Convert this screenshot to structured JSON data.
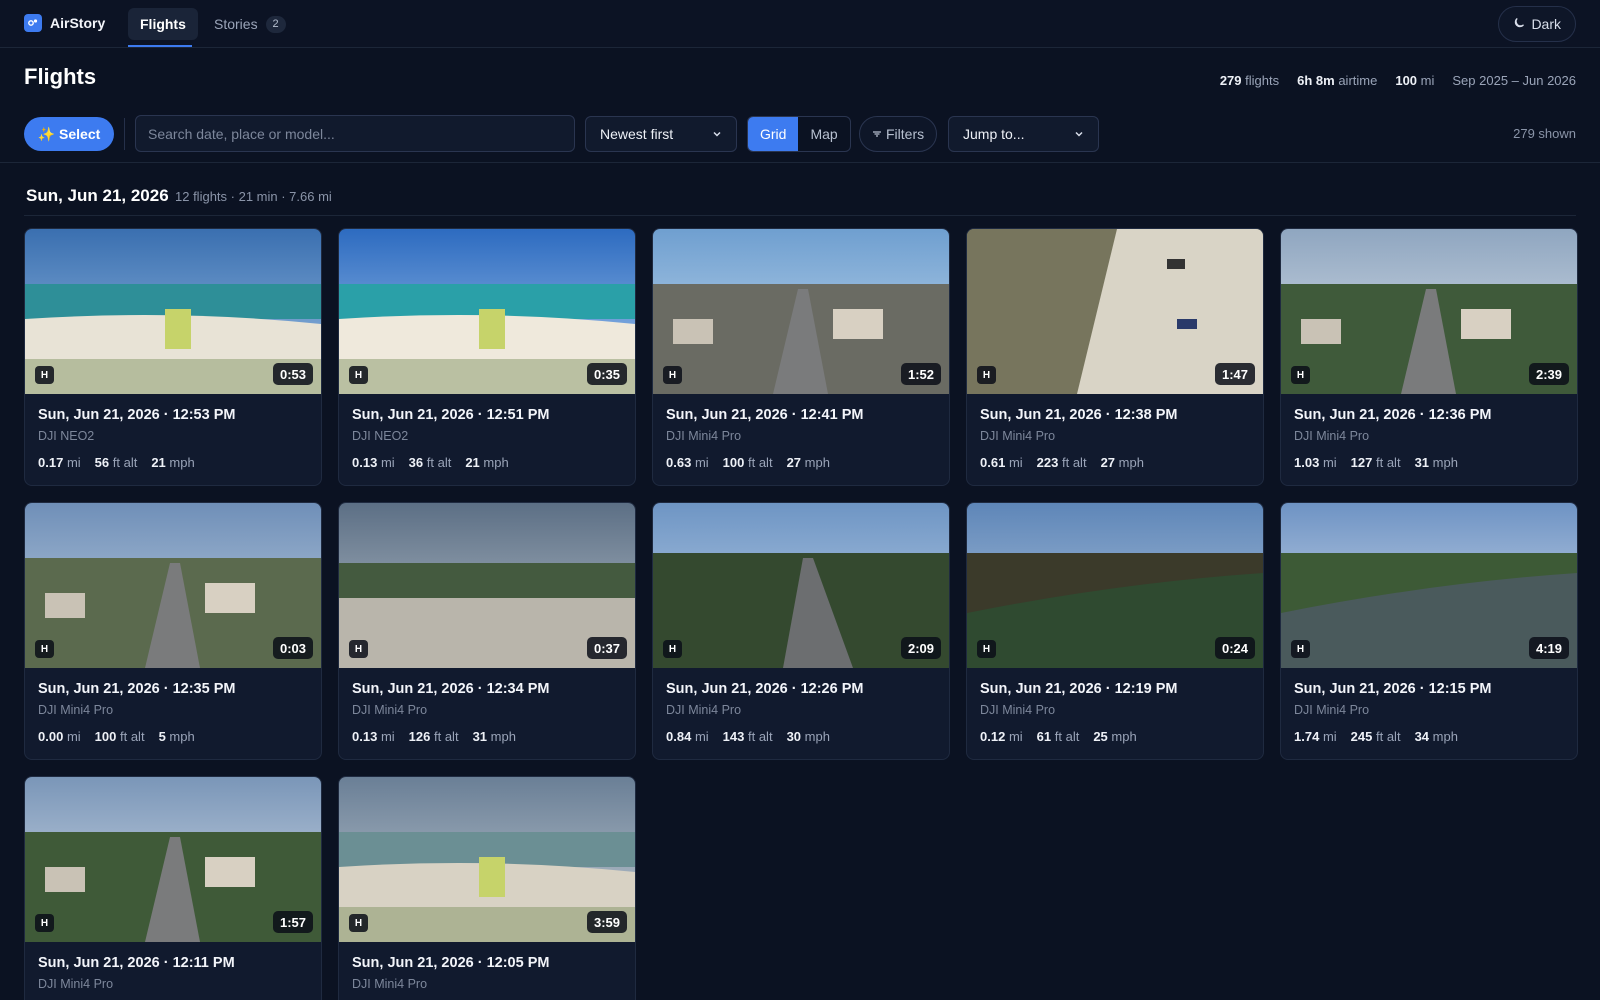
{
  "app": {
    "name": "AirStory"
  },
  "nav": {
    "tabs": [
      {
        "label": "Flights"
      },
      {
        "label": "Stories",
        "badge": "2"
      }
    ],
    "theme_label": "Dark"
  },
  "header": {
    "title": "Flights",
    "stats": {
      "flights_value": "279",
      "flights_unit": "flights",
      "airtime_value": "6h 8m",
      "airtime_unit": "airtime",
      "distance_value": "100",
      "distance_unit": "mi",
      "date_range": "Sep 2025 – Jun 2026"
    }
  },
  "toolbar": {
    "select_label": "✨ Select",
    "search_placeholder": "Search date, place or model...",
    "sort_value": "Newest first",
    "view_grid": "Grid",
    "view_map": "Map",
    "filters_label": "Filters",
    "jump_value": "Jump to...",
    "shown_text": "279 shown"
  },
  "group": {
    "title": "Sun, Jun 21, 2026",
    "meta": "12 flights · 21 min · 7.66 mi"
  },
  "flights": [
    {
      "title": "Sun, Jun 21, 2026 · 12:53 PM",
      "model": "DJI NEO2",
      "duration": "0:53",
      "badge": "H",
      "dist": "0.17",
      "alt": "56",
      "speed": "21"
    },
    {
      "title": "Sun, Jun 21, 2026 · 12:51 PM",
      "model": "DJI NEO2",
      "duration": "0:35",
      "badge": "H",
      "dist": "0.13",
      "alt": "36",
      "speed": "21"
    },
    {
      "title": "Sun, Jun 21, 2026 · 12:41 PM",
      "model": "DJI Mini4 Pro",
      "duration": "1:52",
      "badge": "H",
      "dist": "0.63",
      "alt": "100",
      "speed": "27"
    },
    {
      "title": "Sun, Jun 21, 2026 · 12:38 PM",
      "model": "DJI Mini4 Pro",
      "duration": "1:47",
      "badge": "H",
      "dist": "0.61",
      "alt": "223",
      "speed": "27"
    },
    {
      "title": "Sun, Jun 21, 2026 · 12:36 PM",
      "model": "DJI Mini4 Pro",
      "duration": "2:39",
      "badge": "H",
      "dist": "1.03",
      "alt": "127",
      "speed": "31"
    },
    {
      "title": "Sun, Jun 21, 2026 · 12:35 PM",
      "model": "DJI Mini4 Pro",
      "duration": "0:03",
      "badge": "H",
      "dist": "0.00",
      "alt": "100",
      "speed": "5"
    },
    {
      "title": "Sun, Jun 21, 2026 · 12:34 PM",
      "model": "DJI Mini4 Pro",
      "duration": "0:37",
      "badge": "H",
      "dist": "0.13",
      "alt": "126",
      "speed": "31"
    },
    {
      "title": "Sun, Jun 21, 2026 · 12:26 PM",
      "model": "DJI Mini4 Pro",
      "duration": "2:09",
      "badge": "H",
      "dist": "0.84",
      "alt": "143",
      "speed": "30"
    },
    {
      "title": "Sun, Jun 21, 2026 · 12:19 PM",
      "model": "DJI Mini4 Pro",
      "duration": "0:24",
      "badge": "H",
      "dist": "0.12",
      "alt": "61",
      "speed": "25"
    },
    {
      "title": "Sun, Jun 21, 2026 · 12:15 PM",
      "model": "DJI Mini4 Pro",
      "duration": "4:19",
      "badge": "H",
      "dist": "1.74",
      "alt": "245",
      "speed": "34"
    },
    {
      "title": "Sun, Jun 21, 2026 · 12:11 PM",
      "model": "DJI Mini4 Pro",
      "duration": "1:57",
      "badge": "H",
      "dist": "",
      "alt": "",
      "speed": ""
    },
    {
      "title": "Sun, Jun 21, 2026 · 12:05 PM",
      "model": "DJI Mini4 Pro",
      "duration": "3:59",
      "badge": "H",
      "dist": "",
      "alt": "",
      "speed": ""
    }
  ],
  "units": {
    "dist": "mi",
    "alt": "ft alt",
    "speed": "mph"
  }
}
